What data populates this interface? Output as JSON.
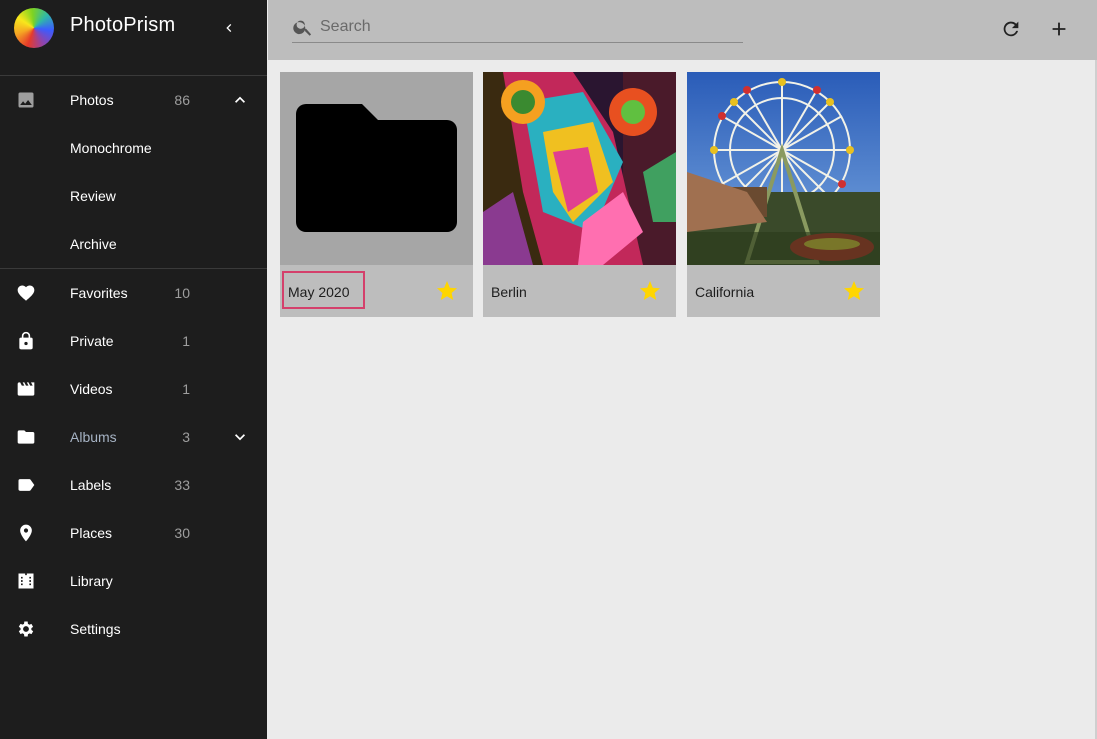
{
  "app": {
    "title": "PhotoPrism"
  },
  "search": {
    "placeholder": "Search",
    "value": ""
  },
  "sidebar": {
    "items": [
      {
        "label": "Photos",
        "count": "86",
        "icon": "image-icon",
        "expanded": true
      },
      {
        "label": "Monochrome",
        "sub": true
      },
      {
        "label": "Review",
        "sub": true
      },
      {
        "label": "Archive",
        "sub": true
      },
      {
        "label": "Favorites",
        "count": "10",
        "icon": "heart-icon"
      },
      {
        "label": "Private",
        "count": "1",
        "icon": "lock-icon"
      },
      {
        "label": "Videos",
        "count": "1",
        "icon": "movie-icon"
      },
      {
        "label": "Albums",
        "count": "3",
        "icon": "folder-icon",
        "active": true
      },
      {
        "label": "Labels",
        "count": "33",
        "icon": "label-icon"
      },
      {
        "label": "Places",
        "count": "30",
        "icon": "place-icon"
      },
      {
        "label": "Library",
        "icon": "library-icon"
      },
      {
        "label": "Settings",
        "icon": "gear-icon"
      }
    ]
  },
  "albums": [
    {
      "title": "May 2020",
      "favorite": true,
      "thumb": "folder-placeholder"
    },
    {
      "title": "Berlin",
      "favorite": true,
      "thumb": "graffiti-photo"
    },
    {
      "title": "California",
      "favorite": true,
      "thumb": "ferris-wheel-photo"
    }
  ],
  "colors": {
    "sidebar_bg": "#1d1d1d",
    "toolbar_bg": "#bdbdbd",
    "star": "#ffd600",
    "highlight": "#d4406b",
    "active_nav": "#a6b3c4"
  }
}
